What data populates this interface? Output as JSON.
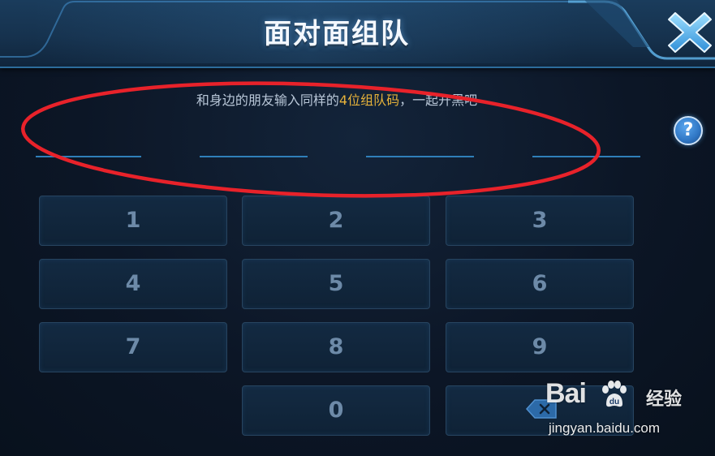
{
  "header": {
    "title": "面对面组队"
  },
  "hint": {
    "prefix": "和身边的朋友输入同样的",
    "highlight": "4位组队码",
    "suffix": "，一起开黑吧"
  },
  "help": {
    "label": "?"
  },
  "keypad": {
    "keys": [
      "1",
      "2",
      "3",
      "4",
      "5",
      "6",
      "7",
      "8",
      "9",
      "0"
    ]
  },
  "watermark": {
    "logo_left": "Bai",
    "logo_right": "经验",
    "url": "jingyan.baidu.com"
  },
  "colors": {
    "highlight": "#e6b23a",
    "annotation_circle": "#e8222a",
    "accent_blue": "#2f7fb9"
  },
  "icons": {
    "close": "close-x-icon",
    "help": "question-icon",
    "delete": "backspace-icon"
  }
}
